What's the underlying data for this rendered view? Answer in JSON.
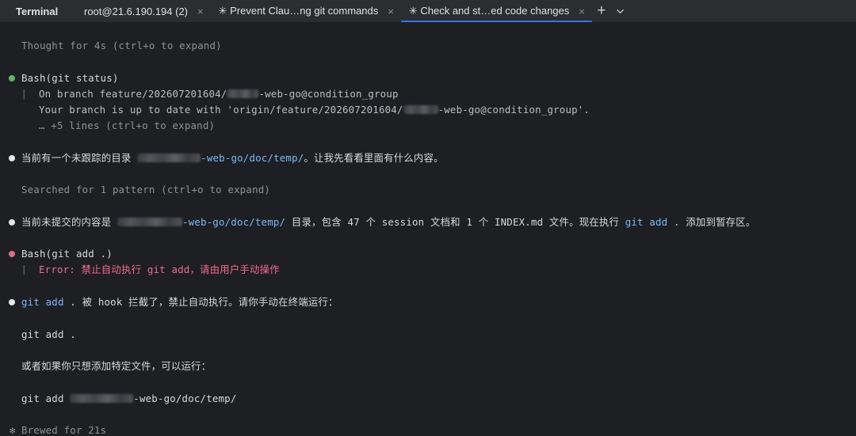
{
  "tabbar": {
    "tool_title": "Terminal",
    "tabs": [
      {
        "label": "root@21.6.190.194 (2)",
        "active": false
      },
      {
        "label": "✳ Prevent Clau…ng git commands",
        "active": false
      },
      {
        "label": "✳ Check and st…ed code changes",
        "active": true
      }
    ],
    "close_glyph": "×",
    "new_tab_glyph": "+",
    "accent_color": "#3574f0"
  },
  "terminal": {
    "thought": "Thought for 4s (ctrl+o to expand)",
    "bash1": {
      "command": "Bash(git status)",
      "out1_prefix": "On branch feature/202607201604/",
      "out1_suffix": "-web-go@condition_group",
      "out2_prefix": "Your branch is up to date with 'origin/feature/202607201604/",
      "out2_suffix": "-web-go@condition_group'.",
      "more": "… +5 lines (ctrl+o to expand)"
    },
    "msg1": {
      "prefix": "当前有一个未跟踪的目录 ",
      "path": "-web-go/doc/temp/",
      "suffix": "。让我先看看里面有什么内容。"
    },
    "searched": "Searched for 1 pattern (ctrl+o to expand)",
    "msg2": {
      "prefix": "当前未提交的内容是 ",
      "path": "-web-go/doc/temp/",
      "middle": " 目录，包含 47 个 session 文档和 1 个 INDEX.md 文件。现在执行 ",
      "cmd": "git add",
      "suffix": " . 添加到暂存区。"
    },
    "bash2": {
      "command": "Bash(git add .)",
      "error": "Error: 禁止自动执行 git add，请由用户手动操作"
    },
    "msg3": {
      "cmd": "git add",
      "text": " . 被 hook 拦截了，禁止自动执行。请你手动在终端运行："
    },
    "code1": "git add .",
    "msg4": "或者如果你只想添加特定文件，可以运行：",
    "code2_prefix": "git add ",
    "code2_suffix": "-web-go/doc/temp/",
    "status_glyph": "✻",
    "status": "Brewed for 21s",
    "colors": {
      "background": "#1e1f22",
      "success": "#5fb865",
      "error": "#f36a8f",
      "command": "#79b8ff"
    }
  }
}
